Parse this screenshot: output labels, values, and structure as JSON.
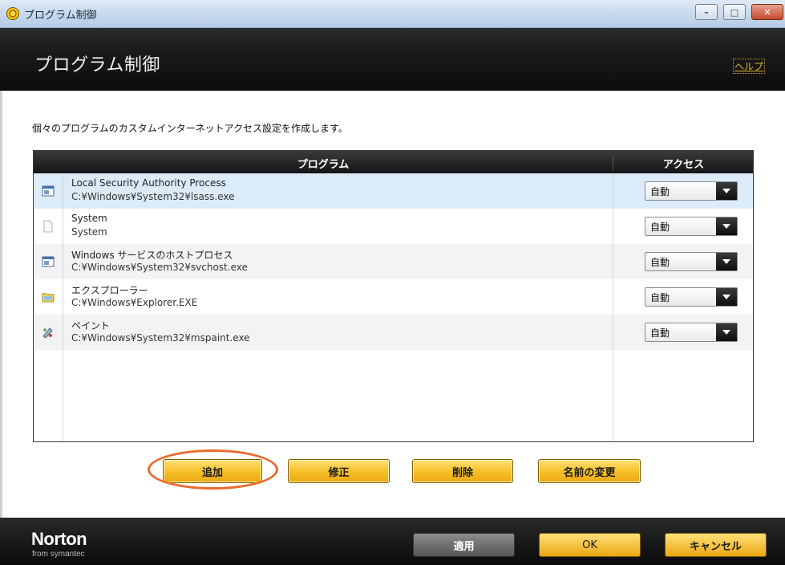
{
  "window": {
    "title": "プログラム制御",
    "minimize_glyph": "–",
    "maximize_glyph": "□",
    "close_glyph": "✕"
  },
  "header": {
    "title": "プログラム制御",
    "help_label": "ヘルプ"
  },
  "description": "個々のプログラムのカスタムインターネットアクセス設定を作成します。",
  "table": {
    "columns": [
      "プログラム",
      "アクセス"
    ],
    "rows": [
      {
        "name": "Local Security Authority Process",
        "path": "C:¥Windows¥System32¥lsass.exe",
        "access": "自動",
        "icon": "application-window-icon",
        "selected": true
      },
      {
        "name": "System",
        "path": "System",
        "access": "自動",
        "icon": "blank-document-icon",
        "selected": false
      },
      {
        "name": "Windows サービスのホストプロセス",
        "path": "C:¥Windows¥System32¥svchost.exe",
        "access": "自動",
        "icon": "application-window-icon",
        "selected": false
      },
      {
        "name": "エクスプローラー",
        "path": "C:¥Windows¥Explorer.EXE",
        "access": "自動",
        "icon": "folder-icon",
        "selected": false
      },
      {
        "name": "ペイント",
        "path": "C:¥Windows¥System32¥mspaint.exe",
        "access": "自動",
        "icon": "paint-icon",
        "selected": false
      }
    ]
  },
  "actions": {
    "add": "追加",
    "edit": "修正",
    "delete": "削除",
    "rename": "名前の変更"
  },
  "footer": {
    "brand": "Norton",
    "brand_sub": "from symantec",
    "apply": "適用",
    "ok": "OK",
    "cancel": "キャンセル"
  },
  "colors": {
    "accent": "#f6c22b",
    "highlight_ring": "#ea6a2a",
    "selected_row": "#dcebf8"
  }
}
